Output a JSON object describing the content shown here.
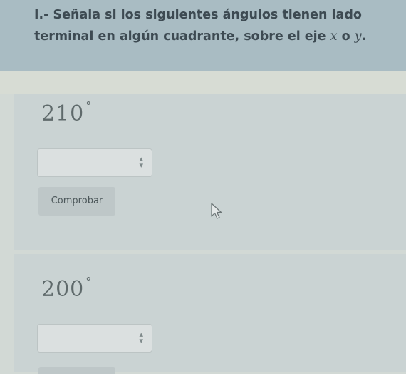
{
  "instructions": {
    "text_before": "I.- Señala si los siguientes ángulos tienen lado terminal en algún cuadrante, sobre el eje ",
    "var_x": "x",
    "text_or": " o ",
    "var_y": "y",
    "text_after": "."
  },
  "questions": [
    {
      "angle_value": "210",
      "degree_symbol": "°",
      "answer_selected": "",
      "check_label": "Comprobar"
    },
    {
      "angle_value": "200",
      "degree_symbol": "°",
      "answer_selected": ""
    }
  ],
  "icons": {
    "select_arrows": "updown-arrows-icon",
    "cursor": "mouse-pointer-icon"
  }
}
